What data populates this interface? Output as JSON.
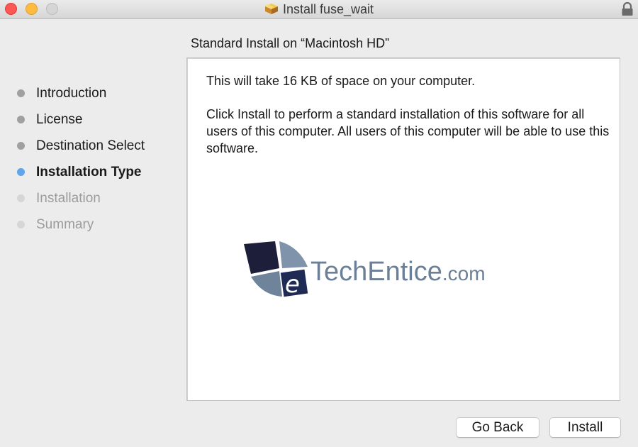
{
  "window": {
    "title": "Install fuse_wait",
    "title_icon": "package-icon",
    "lock_icon": "lock-icon"
  },
  "steps": [
    {
      "label": "Introduction",
      "state": "done"
    },
    {
      "label": "License",
      "state": "done"
    },
    {
      "label": "Destination Select",
      "state": "done"
    },
    {
      "label": "Installation Type",
      "state": "current"
    },
    {
      "label": "Installation",
      "state": "future"
    },
    {
      "label": "Summary",
      "state": "future"
    }
  ],
  "pane": {
    "title": "Standard Install on “Macintosh HD”",
    "space_text": "This will take 16 KB of space on your computer.",
    "description": "Click Install to perform a standard installation of this software for all users of this computer. All users of this computer will be able to use this software."
  },
  "watermark": {
    "brand": "TechEntice",
    "suffix": ".com"
  },
  "buttons": {
    "back": "Go Back",
    "install": "Install"
  },
  "colors": {
    "current_step": "#5fa5ec",
    "close": "#fc5753",
    "minimize": "#fdbc40",
    "zoom": "#d5d5d5"
  }
}
